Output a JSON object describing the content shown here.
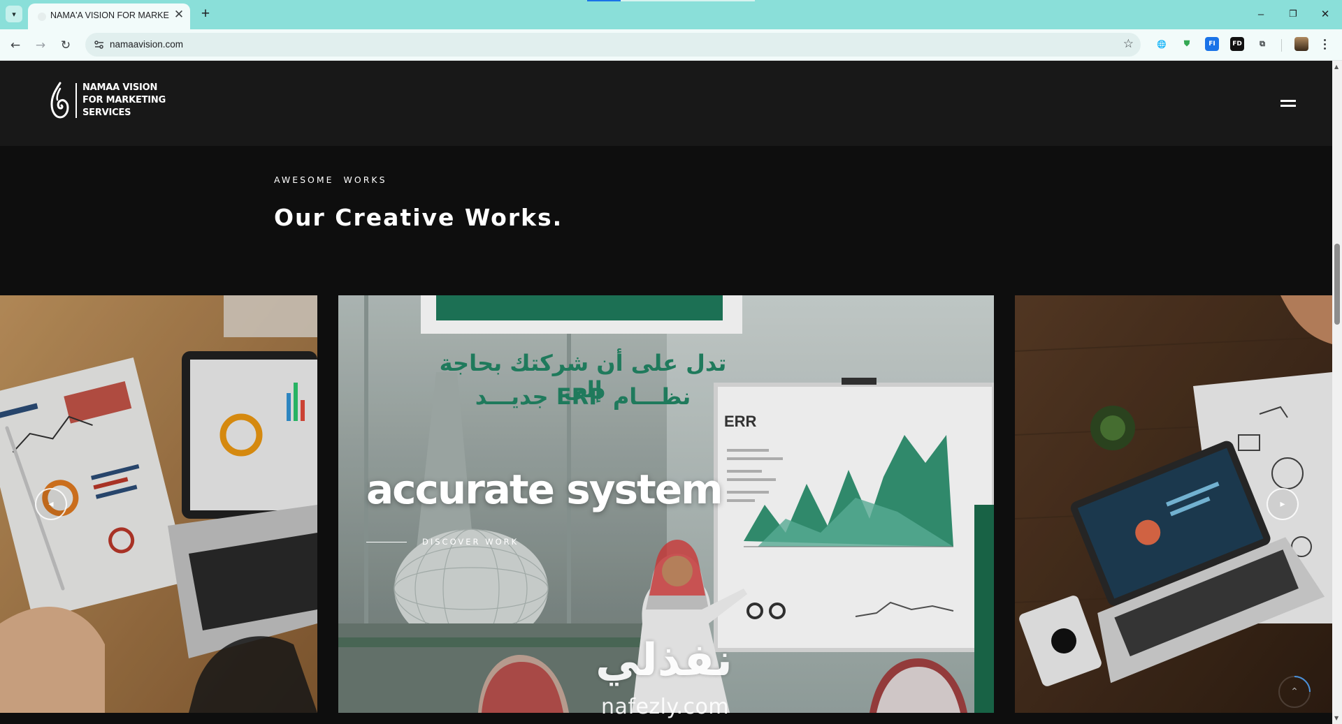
{
  "browser": {
    "tab_title": "NAMA'A VISION FOR MARKETI",
    "tab_close": "✕",
    "new_tab": "+",
    "url": "namaavision.com",
    "window_controls": {
      "minimize": "–",
      "restore": "❐",
      "close": "✕"
    },
    "nav": {
      "back": "←",
      "forward": "→",
      "reload": "↻"
    },
    "extensions": [
      {
        "name": "translate-extension-icon",
        "glyph": "🌐",
        "color": "#5f6368"
      },
      {
        "name": "shield-extension-icon",
        "glyph": "⛊",
        "color": "#34a853"
      },
      {
        "name": "fi-extension-icon",
        "glyph": "FI",
        "color": "#1a73e8"
      },
      {
        "name": "fd-extension-icon",
        "glyph": "FD",
        "color": "#000000"
      },
      {
        "name": "puzzle-extensions-icon",
        "glyph": "⧉",
        "color": "#3c4043"
      }
    ]
  },
  "site": {
    "logo_lines": [
      "NAMAA VISION",
      "FOR MARKETING",
      "SERVICES"
    ],
    "section_label": "AWESOME  WORKS",
    "section_title": "Our Creative Works.",
    "slider": {
      "active_caption_title": "accurate system",
      "active_caption_link": "DISCOVER WORK",
      "ad_headline_line1": "تدل على أن شركتك بحاجة إلى",
      "ad_headline_line2": "نظـــام ERP جديـــد",
      "board_label": "ERR",
      "prev_arrow": "◂",
      "next_arrow": "▸"
    },
    "to_top_icon": "⌃"
  },
  "watermark": {
    "arabic": "نفذلي",
    "latin": "nafezly.com"
  },
  "colors": {
    "tabbar": "#8adfd9",
    "toolbar": "#f2fbfa",
    "header_bg": "#181818",
    "page_bg": "#0e0e0e",
    "accent_green": "#1f7a5c"
  }
}
